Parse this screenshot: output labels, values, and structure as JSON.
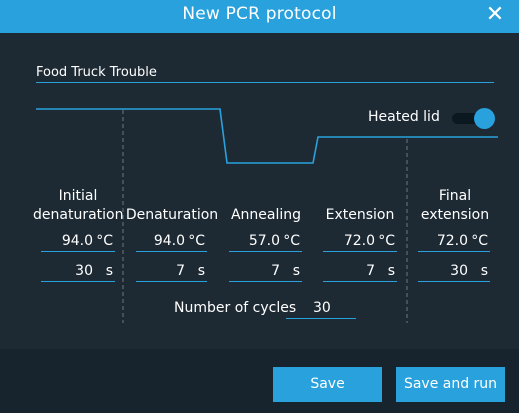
{
  "dialog": {
    "title": "New PCR protocol",
    "close_glyph": "✕",
    "accent_color": "#29a1dd",
    "background_color": "#1d2a34"
  },
  "protocol_name": "Food Truck Trouble",
  "heated_lid": {
    "label": "Heated lid",
    "on": true
  },
  "steps": [
    {
      "label_line1": "Initial",
      "label_line2": "denaturation",
      "temperature": "94.0",
      "temp_unit": "°C",
      "duration": "30",
      "duration_unit": "s"
    },
    {
      "label_line1": "",
      "label_line2": "Denaturation",
      "temperature": "94.0",
      "temp_unit": "°C",
      "duration": "7",
      "duration_unit": "s"
    },
    {
      "label_line1": "",
      "label_line2": "Annealing",
      "temperature": "57.0",
      "temp_unit": "°C",
      "duration": "7",
      "duration_unit": "s"
    },
    {
      "label_line1": "",
      "label_line2": "Extension",
      "temperature": "72.0",
      "temp_unit": "°C",
      "duration": "7",
      "duration_unit": "s"
    },
    {
      "label_line1": "Final",
      "label_line2": "extension",
      "temperature": "72.0",
      "temp_unit": "°C",
      "duration": "30",
      "duration_unit": "s"
    }
  ],
  "cycles": {
    "label": "Number of cycles",
    "value": "30"
  },
  "buttons": {
    "save": "Save",
    "save_and_run": "Save and run"
  }
}
